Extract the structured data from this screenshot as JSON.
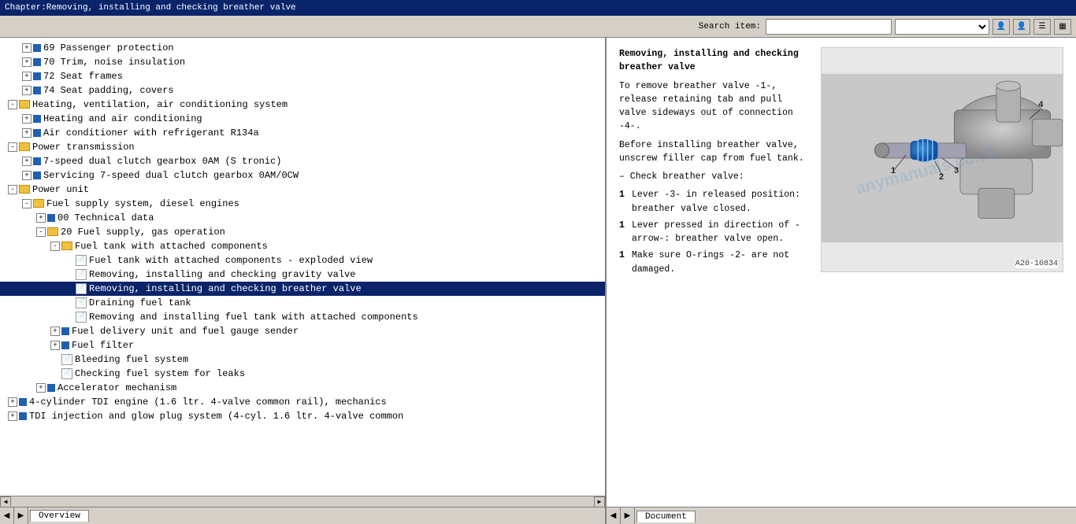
{
  "titleBar": {
    "text": "Chapter:Removing, installing and checking breather valve"
  },
  "toolbar": {
    "searchLabel": "Search item:",
    "searchPlaceholder": "",
    "iconUser1": "👤",
    "iconUser2": "👤",
    "iconMenu": "☰",
    "iconMore": "▦"
  },
  "tree": {
    "items": [
      {
        "id": 1,
        "indent": 1,
        "type": "expandable-leaf",
        "icon": "blue",
        "text": "69  Passenger protection",
        "level": 1
      },
      {
        "id": 2,
        "indent": 1,
        "type": "expandable-leaf",
        "icon": "blue",
        "text": "70  Trim, noise insulation",
        "level": 1
      },
      {
        "id": 3,
        "indent": 1,
        "type": "expandable-leaf",
        "icon": "blue",
        "text": "72  Seat frames",
        "level": 1
      },
      {
        "id": 4,
        "indent": 1,
        "type": "expandable-leaf",
        "icon": "blue",
        "text": "74  Seat padding, covers",
        "level": 1
      },
      {
        "id": 5,
        "indent": 0,
        "type": "folder-open",
        "icon": "folder",
        "text": "Heating, ventilation, air conditioning system",
        "level": 0
      },
      {
        "id": 6,
        "indent": 1,
        "type": "expandable-leaf",
        "icon": "blue",
        "text": "Heating and air conditioning",
        "level": 1
      },
      {
        "id": 7,
        "indent": 1,
        "type": "expandable-leaf",
        "icon": "blue",
        "text": "Air conditioner with refrigerant R134a",
        "level": 1
      },
      {
        "id": 8,
        "indent": 0,
        "type": "folder-open",
        "icon": "folder",
        "text": "Power transmission",
        "level": 0
      },
      {
        "id": 9,
        "indent": 1,
        "type": "expandable-leaf",
        "icon": "blue",
        "text": "7-speed dual clutch gearbox 0AM (S tronic)",
        "level": 1
      },
      {
        "id": 10,
        "indent": 1,
        "type": "expandable-leaf",
        "icon": "blue",
        "text": "Servicing 7-speed dual clutch gearbox 0AM/0CW",
        "level": 1
      },
      {
        "id": 11,
        "indent": 0,
        "type": "folder-open",
        "icon": "folder",
        "text": "Power unit",
        "level": 0
      },
      {
        "id": 12,
        "indent": 1,
        "type": "folder-open",
        "icon": "folder",
        "text": "Fuel supply system, diesel engines",
        "level": 1
      },
      {
        "id": 13,
        "indent": 2,
        "type": "expandable-leaf",
        "icon": "blue",
        "text": "00  Technical data",
        "level": 2
      },
      {
        "id": 14,
        "indent": 2,
        "type": "folder-open",
        "icon": "folder",
        "text": "20  Fuel supply, gas operation",
        "level": 2
      },
      {
        "id": 15,
        "indent": 3,
        "type": "folder-open",
        "icon": "folder",
        "text": "Fuel tank with attached components",
        "level": 3
      },
      {
        "id": 16,
        "indent": 4,
        "type": "doc",
        "icon": "doc",
        "text": "Fuel tank with attached components - exploded view",
        "level": 4
      },
      {
        "id": 17,
        "indent": 4,
        "type": "doc",
        "icon": "doc",
        "text": "Removing, installing and checking gravity valve",
        "level": 4
      },
      {
        "id": 18,
        "indent": 4,
        "type": "doc",
        "icon": "doc",
        "text": "Removing, installing and checking breather valve",
        "level": 4,
        "selected": true
      },
      {
        "id": 19,
        "indent": 4,
        "type": "doc",
        "icon": "doc",
        "text": "Draining fuel tank",
        "level": 4
      },
      {
        "id": 20,
        "indent": 4,
        "type": "doc",
        "icon": "doc",
        "text": "Removing and installing fuel tank with attached components",
        "level": 4
      },
      {
        "id": 21,
        "indent": 3,
        "type": "expandable-leaf",
        "icon": "blue",
        "text": "Fuel delivery unit and fuel gauge sender",
        "level": 3
      },
      {
        "id": 22,
        "indent": 3,
        "type": "expandable-leaf",
        "icon": "blue",
        "text": "Fuel filter",
        "level": 3
      },
      {
        "id": 23,
        "indent": 3,
        "type": "doc-plain",
        "icon": "none",
        "text": "Bleeding fuel system",
        "level": 3
      },
      {
        "id": 24,
        "indent": 3,
        "type": "doc-plain",
        "icon": "none",
        "text": "Checking fuel system for leaks",
        "level": 3
      },
      {
        "id": 25,
        "indent": 2,
        "type": "expandable-leaf",
        "icon": "blue",
        "text": "Accelerator mechanism",
        "level": 2
      },
      {
        "id": 26,
        "indent": 0,
        "type": "expandable-leaf",
        "icon": "blue",
        "text": "4-cylinder TDI engine (1.6 ltr. 4-valve common rail), mechanics",
        "level": 0
      },
      {
        "id": 27,
        "indent": 0,
        "type": "expandable-leaf",
        "icon": "blue",
        "text": "TDI injection and glow plug system (4-cyl. 1.6 ltr. 4-valve common",
        "level": 0
      }
    ]
  },
  "rightPanel": {
    "title": "Removing, installing and checking breather valve",
    "paragraphs": [
      "To remove breather valve -1-, release retaining tab and pull valve sideways out of connection -4-.",
      "Before installing breather valve, unscrew filler cap from fuel tank.",
      "– Check breather valve:",
      "Lever -3- in released position: breather valve closed.",
      "Lever pressed in direction of -arrow-: breather valve open.",
      "Make sure O-rings -2- are not damaged."
    ],
    "listItems": [
      {
        "num": "",
        "text": "To remove breather valve -1-, release retaining tab and pull valve sideways out of connection -4-."
      },
      {
        "num": "",
        "text": "Before installing breather valve, unscrew filler cap from fuel tank."
      },
      {
        "num": "–",
        "text": "Check breather valve:"
      },
      {
        "num": "1",
        "text": "Lever -3- in released position: breather valve closed."
      },
      {
        "num": "1",
        "text": "Lever pressed in direction of -arrow-: breather valve open."
      },
      {
        "num": "1",
        "text": "Make sure O-rings -2- are not damaged."
      }
    ],
    "imageLabel": "A20-10834",
    "watermark": "anymanuals.co.uk"
  },
  "statusBar": {
    "leftTab": "Overview",
    "rightTab": "Document"
  }
}
